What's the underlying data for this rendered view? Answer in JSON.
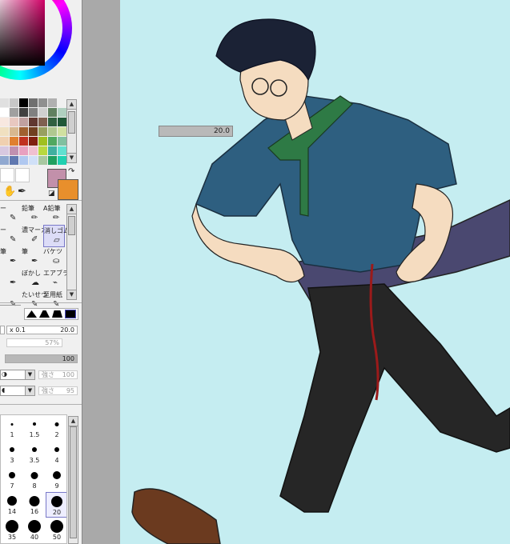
{
  "colors": {
    "main_color": "#c290aa",
    "sub_color": "#e88f2c",
    "canvas_bg": "#c5edf1"
  },
  "swatches": [
    "#e0e0e0",
    "#c8c8c8",
    "#000000",
    "#707070",
    "#909090",
    "#b0b0b0",
    "#f0f0f0",
    "#ffffff",
    "#a0a0a0",
    "#404040",
    "#808080",
    "#d0d0d0",
    "#608060",
    "#b0d0c0",
    "#f8e8e0",
    "#e8c8c0",
    "#c0a0a0",
    "#603830",
    "#806050",
    "#306040",
    "#205838",
    "#f0e0c0",
    "#d8b890",
    "#a06030",
    "#704020",
    "#98a060",
    "#b0c890",
    "#d0e0a0",
    "#f0d0b0",
    "#e08030",
    "#c03020",
    "#802010",
    "#a0c020",
    "#50a860",
    "#80c0a0",
    "#d8c8e0",
    "#c090b0",
    "#e8a0c0",
    "#f0c0d0",
    "#b8d840",
    "#40b0a0",
    "#60e0d0",
    "#90a8d0",
    "#6078b0",
    "#b0c8f0",
    "#d0e0f8",
    "#a8c8a0",
    "#20a060",
    "#20d0b0"
  ],
  "tools": [
    {
      "label": "ー",
      "icon": "pen-icon"
    },
    {
      "label": "鉛筆",
      "icon": "pencil-icon"
    },
    {
      "label": "A鉛筆",
      "icon": "pencil-icon"
    },
    {
      "label": "ー",
      "icon": "pen-icon"
    },
    {
      "label": "濃マーカ",
      "icon": "marker-icon"
    },
    {
      "label": "消しゴム",
      "icon": "eraser-icon"
    },
    {
      "label": "筆",
      "icon": "brush-icon"
    },
    {
      "label": "筆",
      "icon": "brush-icon"
    },
    {
      "label": "バケツ",
      "icon": "bucket-icon"
    },
    {
      "label": "",
      "icon": "brush-icon"
    },
    {
      "label": "ぼかし",
      "icon": "blur-icon"
    },
    {
      "label": "エアブラシ",
      "icon": "airbrush-icon"
    },
    {
      "label": "",
      "icon": "pen-icon"
    },
    {
      "label": "たいせつ",
      "icon": "pen-icon"
    },
    {
      "label": "至用紙",
      "icon": "pen-icon"
    }
  ],
  "brush": {
    "size_mult": "x 0.1",
    "size": "20.0",
    "min_size": "57%",
    "density": "100",
    "strength1_label": "強さ",
    "strength1": "100",
    "strength2_label": "強さ",
    "strength2": "95"
  },
  "brush_sizes": [
    {
      "label": "1",
      "value": 1
    },
    {
      "label": "1.5",
      "value": 1.5
    },
    {
      "label": "2",
      "value": 2
    },
    {
      "label": "3",
      "value": 3
    },
    {
      "label": "3.5",
      "value": 3.5
    },
    {
      "label": "4",
      "value": 4
    },
    {
      "label": "7",
      "value": 7
    },
    {
      "label": "8",
      "value": 8
    },
    {
      "label": "9",
      "value": 9
    },
    {
      "label": "14",
      "value": 14
    },
    {
      "label": "16",
      "value": 16
    },
    {
      "label": "20",
      "value": 20
    },
    {
      "label": "35",
      "value": 35
    },
    {
      "label": "40",
      "value": 40
    },
    {
      "label": "50",
      "value": 50
    }
  ],
  "canvas_popup": {
    "value": "20.0"
  }
}
